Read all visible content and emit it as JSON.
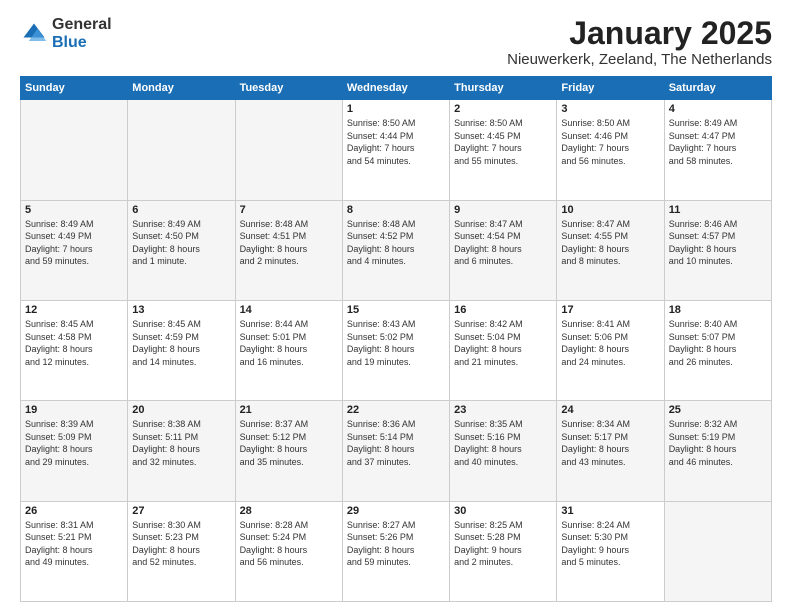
{
  "logo": {
    "general": "General",
    "blue": "Blue"
  },
  "title": "January 2025",
  "subtitle": "Nieuwerkerk, Zeeland, The Netherlands",
  "days_of_week": [
    "Sunday",
    "Monday",
    "Tuesday",
    "Wednesday",
    "Thursday",
    "Friday",
    "Saturday"
  ],
  "weeks": [
    [
      {
        "day": "",
        "info": ""
      },
      {
        "day": "",
        "info": ""
      },
      {
        "day": "",
        "info": ""
      },
      {
        "day": "1",
        "info": "Sunrise: 8:50 AM\nSunset: 4:44 PM\nDaylight: 7 hours\nand 54 minutes."
      },
      {
        "day": "2",
        "info": "Sunrise: 8:50 AM\nSunset: 4:45 PM\nDaylight: 7 hours\nand 55 minutes."
      },
      {
        "day": "3",
        "info": "Sunrise: 8:50 AM\nSunset: 4:46 PM\nDaylight: 7 hours\nand 56 minutes."
      },
      {
        "day": "4",
        "info": "Sunrise: 8:49 AM\nSunset: 4:47 PM\nDaylight: 7 hours\nand 58 minutes."
      }
    ],
    [
      {
        "day": "5",
        "info": "Sunrise: 8:49 AM\nSunset: 4:49 PM\nDaylight: 7 hours\nand 59 minutes."
      },
      {
        "day": "6",
        "info": "Sunrise: 8:49 AM\nSunset: 4:50 PM\nDaylight: 8 hours\nand 1 minute."
      },
      {
        "day": "7",
        "info": "Sunrise: 8:48 AM\nSunset: 4:51 PM\nDaylight: 8 hours\nand 2 minutes."
      },
      {
        "day": "8",
        "info": "Sunrise: 8:48 AM\nSunset: 4:52 PM\nDaylight: 8 hours\nand 4 minutes."
      },
      {
        "day": "9",
        "info": "Sunrise: 8:47 AM\nSunset: 4:54 PM\nDaylight: 8 hours\nand 6 minutes."
      },
      {
        "day": "10",
        "info": "Sunrise: 8:47 AM\nSunset: 4:55 PM\nDaylight: 8 hours\nand 8 minutes."
      },
      {
        "day": "11",
        "info": "Sunrise: 8:46 AM\nSunset: 4:57 PM\nDaylight: 8 hours\nand 10 minutes."
      }
    ],
    [
      {
        "day": "12",
        "info": "Sunrise: 8:45 AM\nSunset: 4:58 PM\nDaylight: 8 hours\nand 12 minutes."
      },
      {
        "day": "13",
        "info": "Sunrise: 8:45 AM\nSunset: 4:59 PM\nDaylight: 8 hours\nand 14 minutes."
      },
      {
        "day": "14",
        "info": "Sunrise: 8:44 AM\nSunset: 5:01 PM\nDaylight: 8 hours\nand 16 minutes."
      },
      {
        "day": "15",
        "info": "Sunrise: 8:43 AM\nSunset: 5:02 PM\nDaylight: 8 hours\nand 19 minutes."
      },
      {
        "day": "16",
        "info": "Sunrise: 8:42 AM\nSunset: 5:04 PM\nDaylight: 8 hours\nand 21 minutes."
      },
      {
        "day": "17",
        "info": "Sunrise: 8:41 AM\nSunset: 5:06 PM\nDaylight: 8 hours\nand 24 minutes."
      },
      {
        "day": "18",
        "info": "Sunrise: 8:40 AM\nSunset: 5:07 PM\nDaylight: 8 hours\nand 26 minutes."
      }
    ],
    [
      {
        "day": "19",
        "info": "Sunrise: 8:39 AM\nSunset: 5:09 PM\nDaylight: 8 hours\nand 29 minutes."
      },
      {
        "day": "20",
        "info": "Sunrise: 8:38 AM\nSunset: 5:11 PM\nDaylight: 8 hours\nand 32 minutes."
      },
      {
        "day": "21",
        "info": "Sunrise: 8:37 AM\nSunset: 5:12 PM\nDaylight: 8 hours\nand 35 minutes."
      },
      {
        "day": "22",
        "info": "Sunrise: 8:36 AM\nSunset: 5:14 PM\nDaylight: 8 hours\nand 37 minutes."
      },
      {
        "day": "23",
        "info": "Sunrise: 8:35 AM\nSunset: 5:16 PM\nDaylight: 8 hours\nand 40 minutes."
      },
      {
        "day": "24",
        "info": "Sunrise: 8:34 AM\nSunset: 5:17 PM\nDaylight: 8 hours\nand 43 minutes."
      },
      {
        "day": "25",
        "info": "Sunrise: 8:32 AM\nSunset: 5:19 PM\nDaylight: 8 hours\nand 46 minutes."
      }
    ],
    [
      {
        "day": "26",
        "info": "Sunrise: 8:31 AM\nSunset: 5:21 PM\nDaylight: 8 hours\nand 49 minutes."
      },
      {
        "day": "27",
        "info": "Sunrise: 8:30 AM\nSunset: 5:23 PM\nDaylight: 8 hours\nand 52 minutes."
      },
      {
        "day": "28",
        "info": "Sunrise: 8:28 AM\nSunset: 5:24 PM\nDaylight: 8 hours\nand 56 minutes."
      },
      {
        "day": "29",
        "info": "Sunrise: 8:27 AM\nSunset: 5:26 PM\nDaylight: 8 hours\nand 59 minutes."
      },
      {
        "day": "30",
        "info": "Sunrise: 8:25 AM\nSunset: 5:28 PM\nDaylight: 9 hours\nand 2 minutes."
      },
      {
        "day": "31",
        "info": "Sunrise: 8:24 AM\nSunset: 5:30 PM\nDaylight: 9 hours\nand 5 minutes."
      },
      {
        "day": "",
        "info": ""
      }
    ]
  ]
}
